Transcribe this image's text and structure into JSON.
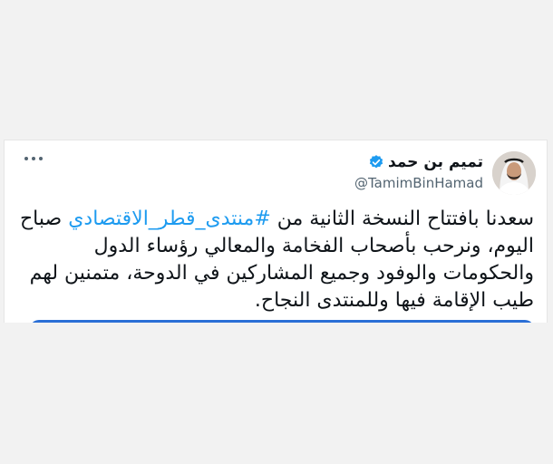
{
  "tweet": {
    "author_name": "تميم بن حمد",
    "author_handle": "@TamimBinHamad",
    "verified": true,
    "text_before_hashtag": "سعدنا بافتتاح النسخة الثانية من ",
    "hashtag": "#منتدى_قطر_الاقتصادي",
    "text_after_hashtag": " صباح اليوم، ونرحب بأصحاب الفخامة والمعالي رؤساء الدول والحكومات والوفود وجميع المشاركين في الدوحة، متمنين لهم طيب الإقامة فيها وللمنتدى النجاح."
  },
  "icons": {
    "more": "more-dots-icon",
    "verified": "verified-badge-icon"
  },
  "colors": {
    "accent": "#1d9bf0",
    "text": "#0f1419",
    "secondary_text": "#536471",
    "media": "#2a6fd6"
  }
}
